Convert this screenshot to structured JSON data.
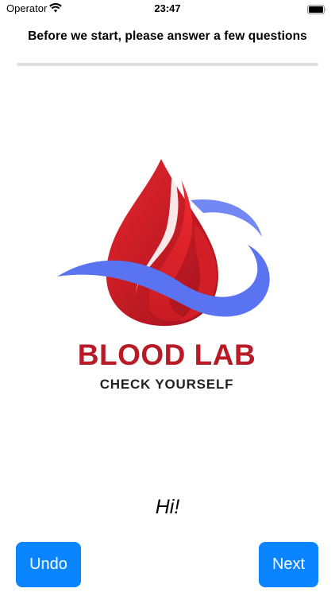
{
  "status_bar": {
    "carrier": "Operator",
    "time": "23:47"
  },
  "header": {
    "title": "Before we start, please answer a few questions"
  },
  "progress": {
    "fraction": 0
  },
  "logo": {
    "title": "BLOOD LAB",
    "subtitle": "CHECK YOURSELF",
    "colors": {
      "red": "#d7222a",
      "dark_red": "#9d1420",
      "blue": "#5a73f0"
    }
  },
  "greeting": "Hi!",
  "buttons": {
    "undo": "Undo",
    "next": "Next"
  },
  "accent_color": "#0a84ff"
}
